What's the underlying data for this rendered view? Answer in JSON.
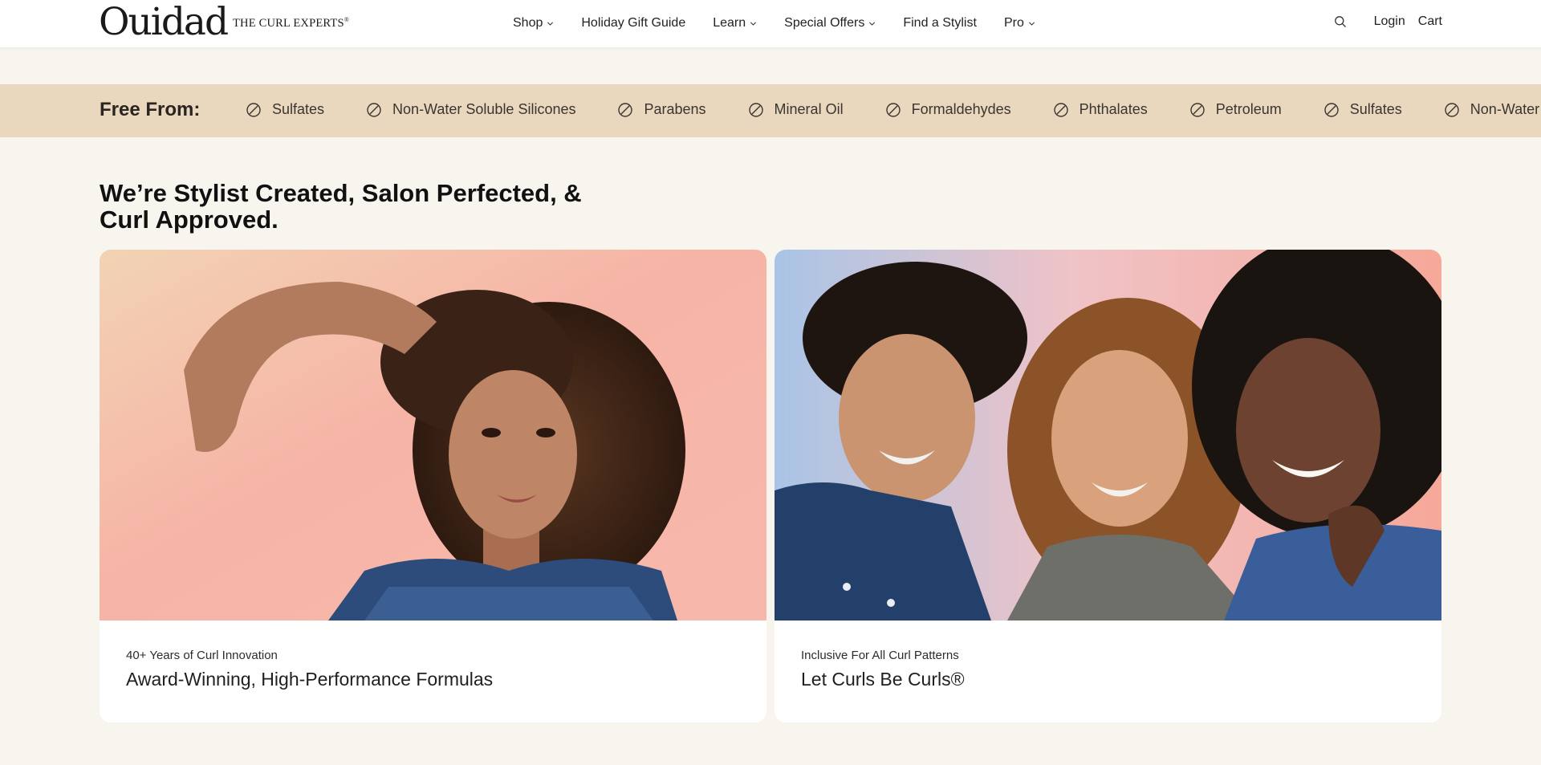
{
  "header": {
    "logo": "Ouidad",
    "tagline": "THE CURL EXPERTS",
    "tagline_mark": "®",
    "nav": [
      {
        "label": "Shop",
        "dropdown": true
      },
      {
        "label": "Holiday Gift Guide",
        "dropdown": false
      },
      {
        "label": "Learn",
        "dropdown": true
      },
      {
        "label": "Special Offers",
        "dropdown": true
      },
      {
        "label": "Find a Stylist",
        "dropdown": false
      },
      {
        "label": "Pro",
        "dropdown": true
      }
    ],
    "login_label": "Login",
    "cart_label": "Cart",
    "search_icon": "search-icon"
  },
  "free_from": {
    "title": "Free From:",
    "icon": "prohibited-icon",
    "items": [
      "Sulfates",
      "Non-Water Soluble Silicones",
      "Parabens",
      "Mineral Oil",
      "Formaldehydes",
      "Phthalates",
      "Petroleum",
      "Sulfates",
      "Non-Water Soluble Silicones"
    ]
  },
  "headline": {
    "line1": "We’re Stylist Created, Salon Perfected, &",
    "line2": "Curl Approved."
  },
  "cards": [
    {
      "eyebrow": "40+ Years of Curl Innovation",
      "title": "Award-Winning, High-Performance Formulas"
    },
    {
      "eyebrow": "Inclusive For All Curl Patterns",
      "title": "Let Curls Be Curls®"
    }
  ],
  "colors": {
    "page_bg": "#f8f5ef",
    "band_bg": "#ead8be",
    "card_bg": "#ffffff"
  }
}
